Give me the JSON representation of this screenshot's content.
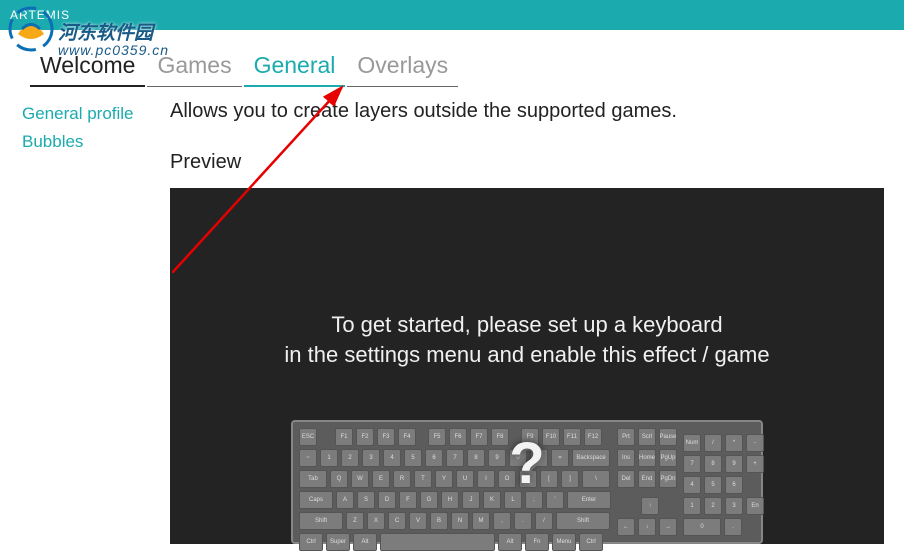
{
  "titlebar": {
    "app_name": "ARTEMIS"
  },
  "watermark": {
    "site_name": "河东软件园",
    "url": "www.pc0359.cn"
  },
  "tabs": [
    {
      "label": "Welcome",
      "state": "first"
    },
    {
      "label": "Games",
      "state": ""
    },
    {
      "label": "General",
      "state": "active"
    },
    {
      "label": "Overlays",
      "state": ""
    }
  ],
  "sidebar": {
    "items": [
      {
        "label": "General profile"
      },
      {
        "label": "Bubbles"
      }
    ]
  },
  "content": {
    "description": "Allows you to create layers outside the supported games.",
    "preview_label": "Preview",
    "preview_message_line1": "To get started, please set up a keyboard",
    "preview_message_line2": "in the settings menu and enable this effect / game",
    "question_mark": "?"
  },
  "colors": {
    "accent": "#1babae",
    "preview_bg": "#232323"
  }
}
